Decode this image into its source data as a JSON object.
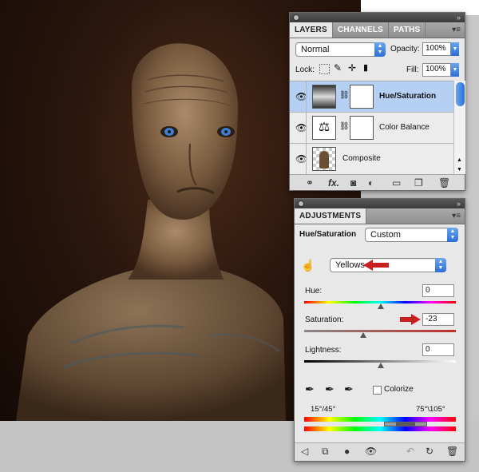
{
  "layers_panel": {
    "tabs": [
      "LAYERS",
      "CHANNELS",
      "PATHS"
    ],
    "blend_mode": "Normal",
    "opacity_label": "Opacity:",
    "opacity_value": "100%",
    "lock_label": "Lock:",
    "fill_label": "Fill:",
    "fill_value": "100%",
    "layers": [
      {
        "name": "Hue/Saturation",
        "selected": true
      },
      {
        "name": "Color Balance",
        "selected": false
      },
      {
        "name": "Composite",
        "selected": false
      }
    ]
  },
  "adjustments_panel": {
    "tab": "ADJUSTMENTS",
    "title": "Hue/Saturation",
    "preset": "Custom",
    "channel": "Yellows",
    "hue_label": "Hue:",
    "hue_value": "0",
    "saturation_label": "Saturation:",
    "saturation_value": "-23",
    "lightness_label": "Lightness:",
    "lightness_value": "0",
    "colorize_label": "Colorize",
    "colorize_checked": false,
    "range_left": "15°/45°",
    "range_right": "75°\\105°"
  },
  "colors": {
    "accent_blue": "#2a6fd6",
    "selected_row": "#b5d0f3",
    "annotation_red": "#c8201e"
  }
}
